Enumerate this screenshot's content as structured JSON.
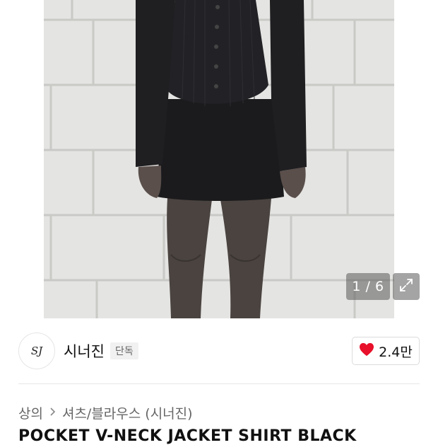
{
  "gallery": {
    "counter": "1 / 6",
    "expand_icon": "expand-icon"
  },
  "brand": {
    "logo_text": "SJ",
    "name": "시너진",
    "badge": "단독"
  },
  "like": {
    "icon": "heart-icon",
    "count": "2.4만",
    "color": "#e8102a"
  },
  "breadcrumb": {
    "category": "상의",
    "subcategory": "셔츠/블라우스 (시너진)"
  },
  "product": {
    "title": "POCKET V-NECK JACKET SHIRT BLACK"
  }
}
